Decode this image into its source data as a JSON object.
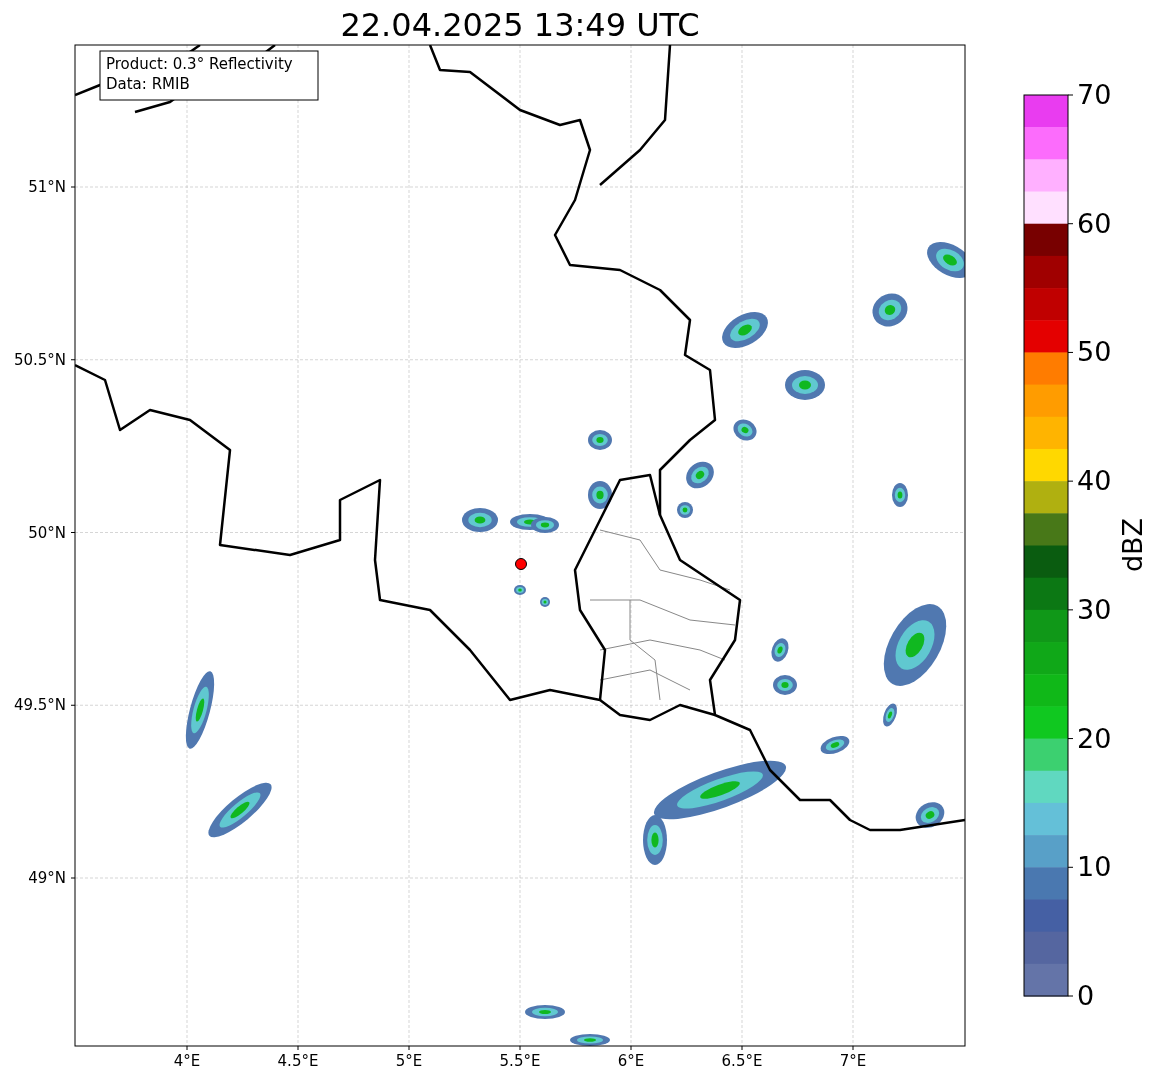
{
  "title": "22.04.2025 13:49 UTC",
  "info_box": {
    "lines": [
      "Product: 0.3° Reflectivity",
      "Data: RMIB"
    ]
  },
  "x_ticks": [
    "4°E",
    "4.5°E",
    "5°E",
    "5.5°E",
    "6°E",
    "6.5°E",
    "7°E"
  ],
  "y_ticks": [
    "51°N",
    "50.5°N",
    "50°N",
    "49.5°N",
    "49°N"
  ],
  "colorbar": {
    "label": "dBZ",
    "ticks": [
      "70",
      "60",
      "50",
      "40",
      "30",
      "20",
      "10",
      "0"
    ],
    "bins": [
      {
        "color": "#e93cf0"
      },
      {
        "color": "#fc6cfc"
      },
      {
        "color": "#ffb0ff"
      },
      {
        "color": "#ffe0ff"
      },
      {
        "color": "#780000"
      },
      {
        "color": "#a00000"
      },
      {
        "color": "#c00000"
      },
      {
        "color": "#e40000"
      },
      {
        "color": "#ff7c00"
      },
      {
        "color": "#ff9c00"
      },
      {
        "color": "#ffb400"
      },
      {
        "color": "#ffd800"
      },
      {
        "color": "#b0b010"
      },
      {
        "color": "#487818"
      },
      {
        "color": "#0a5c10"
      },
      {
        "color": "#0c7814"
      },
      {
        "color": "#109818"
      },
      {
        "color": "#10a818"
      },
      {
        "color": "#10b818"
      },
      {
        "color": "#10c820"
      },
      {
        "color": "#3cd070"
      },
      {
        "color": "#60d8c0"
      },
      {
        "color": "#64c0d8"
      },
      {
        "color": "#58a0c8"
      },
      {
        "color": "#4a78b0"
      },
      {
        "color": "#4560a4"
      },
      {
        "color": "#5566a0"
      },
      {
        "color": "#6474a8"
      }
    ]
  }
}
